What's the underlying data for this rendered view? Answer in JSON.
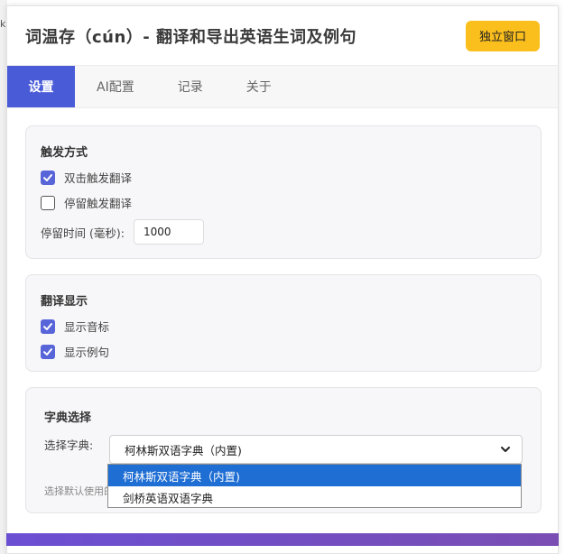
{
  "backdrop": {
    "glyph": "k"
  },
  "header": {
    "title": "词温存（cún）- 翻译和导出英语生词及例句",
    "standalone_button": "独立窗口"
  },
  "tabs": [
    {
      "label": "设置",
      "active": true
    },
    {
      "label": "AI配置",
      "active": false
    },
    {
      "label": "记录",
      "active": false
    },
    {
      "label": "关于",
      "active": false
    }
  ],
  "trigger": {
    "title": "触发方式",
    "double_click": {
      "label": "双击触发翻译",
      "checked": true
    },
    "hover": {
      "label": "停留触发翻译",
      "checked": false
    },
    "dwell_label": "停留时间 (毫秒):",
    "dwell_value": "1000"
  },
  "display": {
    "title": "翻译显示",
    "phonetic": {
      "label": "显示音标",
      "checked": true
    },
    "examples": {
      "label": "显示例句",
      "checked": true
    }
  },
  "dictionary": {
    "title": "字典选择",
    "select_label": "选择字典:",
    "selected": "柯林斯双语字典（内置)",
    "options": [
      "柯林斯双语字典（内置)",
      "剑桥英语双语字典"
    ],
    "help_text": "选择默认使用的"
  },
  "colors": {
    "accent": "#4a5bd8",
    "button": "#fbbf1d",
    "checkbox": "#5865d9",
    "option_highlight": "#1f6ed4"
  }
}
